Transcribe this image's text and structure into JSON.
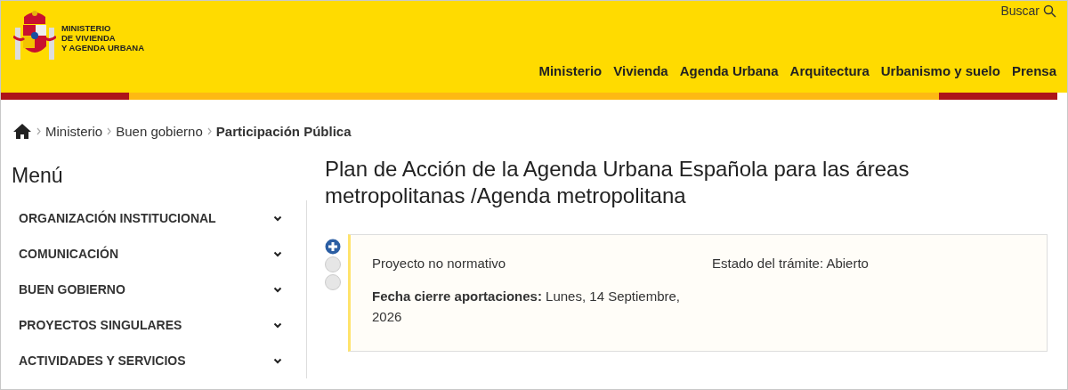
{
  "header": {
    "logo_text": [
      "MINISTERIO",
      "DE VIVIENDA",
      "Y AGENDA URBANA"
    ],
    "search": {
      "label": "Buscar"
    },
    "nav": [
      {
        "label": "Ministerio"
      },
      {
        "label": "Vivienda"
      },
      {
        "label": "Agenda Urbana"
      },
      {
        "label": "Arquitectura"
      },
      {
        "label": "Urbanismo y suelo"
      },
      {
        "label": "Prensa"
      }
    ]
  },
  "breadcrumb": [
    {
      "label": "Ministerio",
      "current": false
    },
    {
      "label": "Buen gobierno",
      "current": false
    },
    {
      "label": "Participación Pública",
      "current": true
    }
  ],
  "sidebar": {
    "title": "Menú",
    "items": [
      {
        "label": "ORGANIZACIÓN INSTITUCIONAL",
        "expanded": false
      },
      {
        "label": "COMUNICACIÓN",
        "expanded": false
      },
      {
        "label": "BUEN GOBIERNO",
        "expanded": false
      },
      {
        "label": "PROYECTOS SINGULARES",
        "expanded": false
      },
      {
        "label": "ACTIVIDADES Y SERVICIOS",
        "expanded": false
      }
    ]
  },
  "main": {
    "title": "Plan de Acción de la Agenda Urbana Española para las áreas metropolitanas /Agenda metropolitana",
    "markers": [
      {
        "kind": "plus"
      },
      {
        "kind": "blank"
      },
      {
        "kind": "blank"
      }
    ],
    "card": {
      "type": "Proyecto no normativo",
      "status": "Estado del trámite: Abierto",
      "deadline": "**Fecha cierre aportaciones:** Lunes, 14 Septiembre, 2026"
    }
  }
}
